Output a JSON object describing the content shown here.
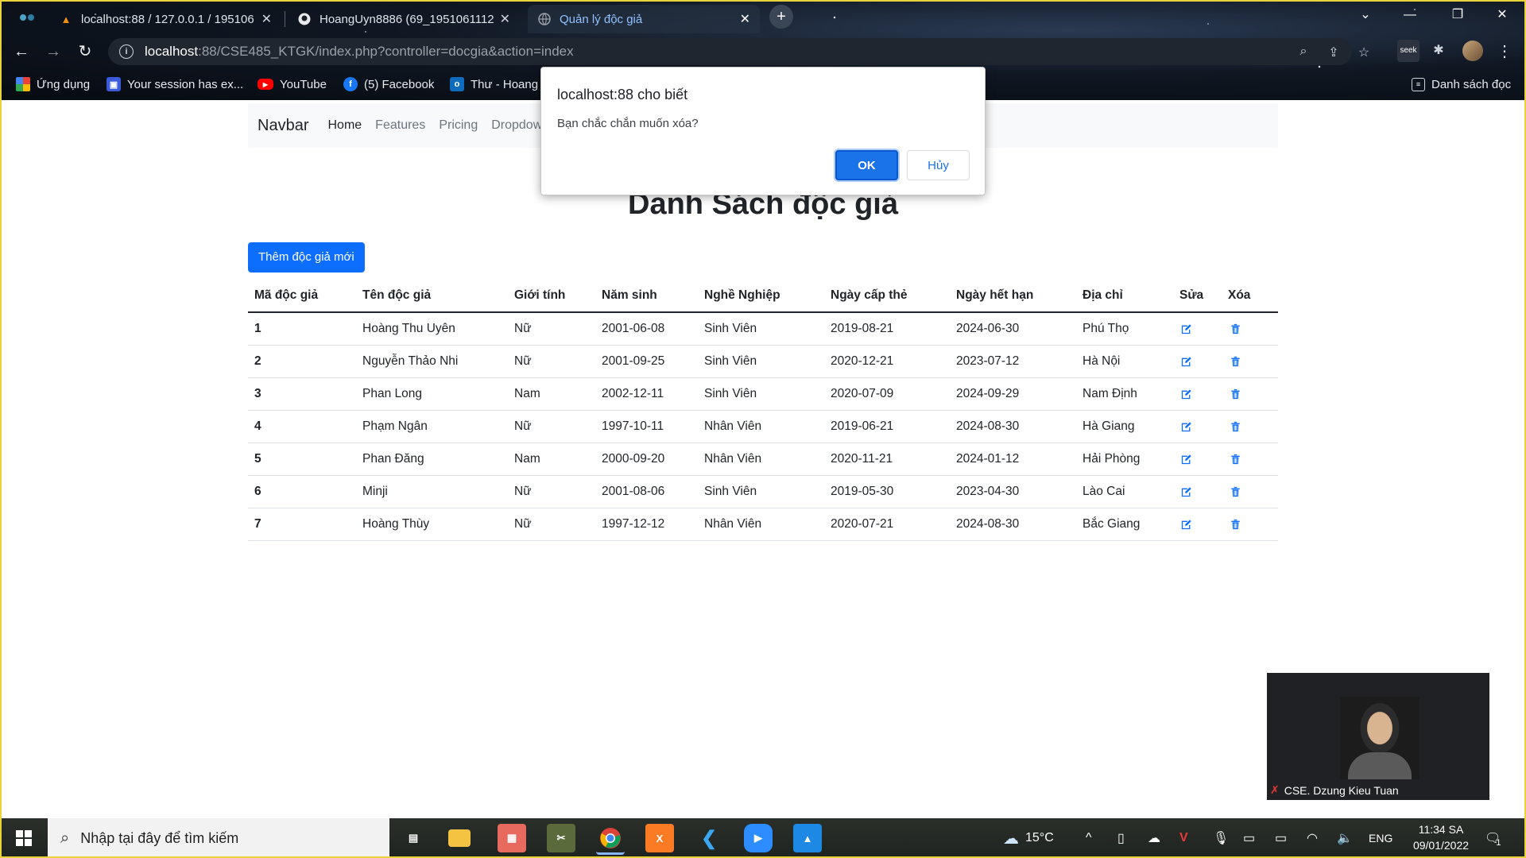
{
  "browser": {
    "tabs": [
      {
        "title": "localhost:88 / 127.0.0.1 / 195106",
        "active": false
      },
      {
        "title": "HoangUyn8886 (69_1951061112",
        "active": false
      },
      {
        "title": "Quản lý độc giả",
        "active": true
      }
    ],
    "url_host": "localhost",
    "url_rest": ":88/CSE485_KTGK/index.php?controller=docgia&action=index",
    "bookmarks": [
      "Ứng dụng",
      "Your session has ex...",
      "YouTube",
      "(5) Facebook",
      "Thư - Hoang"
    ],
    "reading_list": "Danh sách đọc"
  },
  "navbar": {
    "brand": "Navbar",
    "links": [
      "Home",
      "Features",
      "Pricing",
      "Dropdown"
    ]
  },
  "page": {
    "title": "Danh Sách độc giả",
    "add_button": "Thêm độc giả mới"
  },
  "table": {
    "headers": [
      "Mã độc giả",
      "Tên độc giả",
      "Giới tính",
      "Năm sinh",
      "Nghề Nghiệp",
      "Ngày cấp thẻ",
      "Ngày hết hạn",
      "Địa chỉ",
      "Sửa",
      "Xóa"
    ],
    "rows": [
      {
        "id": "1",
        "name": "Hoàng Thu Uyên",
        "gender": "Nữ",
        "birth": "2001-06-08",
        "job": "Sinh Viên",
        "issued": "2019-08-21",
        "expires": "2024-06-30",
        "address": "Phú Thọ"
      },
      {
        "id": "2",
        "name": "Nguyễn Thảo Nhi",
        "gender": "Nữ",
        "birth": "2001-09-25",
        "job": "Sinh Viên",
        "issued": "2020-12-21",
        "expires": "2023-07-12",
        "address": "Hà Nội"
      },
      {
        "id": "3",
        "name": "Phan Long",
        "gender": "Nam",
        "birth": "2002-12-11",
        "job": "Sinh Viên",
        "issued": "2020-07-09",
        "expires": "2024-09-29",
        "address": "Nam Định"
      },
      {
        "id": "4",
        "name": "Phạm Ngân",
        "gender": "Nữ",
        "birth": "1997-10-11",
        "job": "Nhân Viên",
        "issued": "2019-06-21",
        "expires": "2024-08-30",
        "address": "Hà Giang"
      },
      {
        "id": "5",
        "name": "Phan Đăng",
        "gender": "Nam",
        "birth": "2000-09-20",
        "job": "Nhân Viên",
        "issued": "2020-11-21",
        "expires": "2024-01-12",
        "address": "Hải Phòng"
      },
      {
        "id": "6",
        "name": "Minji",
        "gender": "Nữ",
        "birth": "2001-08-06",
        "job": "Sinh Viên",
        "issued": "2019-05-30",
        "expires": "2023-04-30",
        "address": "Lào Cai"
      },
      {
        "id": "7",
        "name": "Hoàng Thùy",
        "gender": "Nữ",
        "birth": "1997-12-12",
        "job": "Nhân Viên",
        "issued": "2020-07-21",
        "expires": "2024-08-30",
        "address": "Bắc Giang"
      }
    ]
  },
  "dialog": {
    "title": "localhost:88 cho biết",
    "message": "Bạn chắc chắn muốn xóa?",
    "ok": "OK",
    "cancel": "Hủy"
  },
  "video": {
    "participant": "CSE. Dzung Kieu Tuan"
  },
  "taskbar": {
    "search_placeholder": "Nhập tại đây để tìm kiếm",
    "weather": "15°C",
    "language": "ENG",
    "time": "11:34 SA",
    "date": "09/01/2022",
    "notification_count": "1"
  },
  "colors": {
    "primary": "#0d6efd",
    "dialog_ok": "#1a73e8",
    "navbar_bg": "#f8f9fa"
  }
}
